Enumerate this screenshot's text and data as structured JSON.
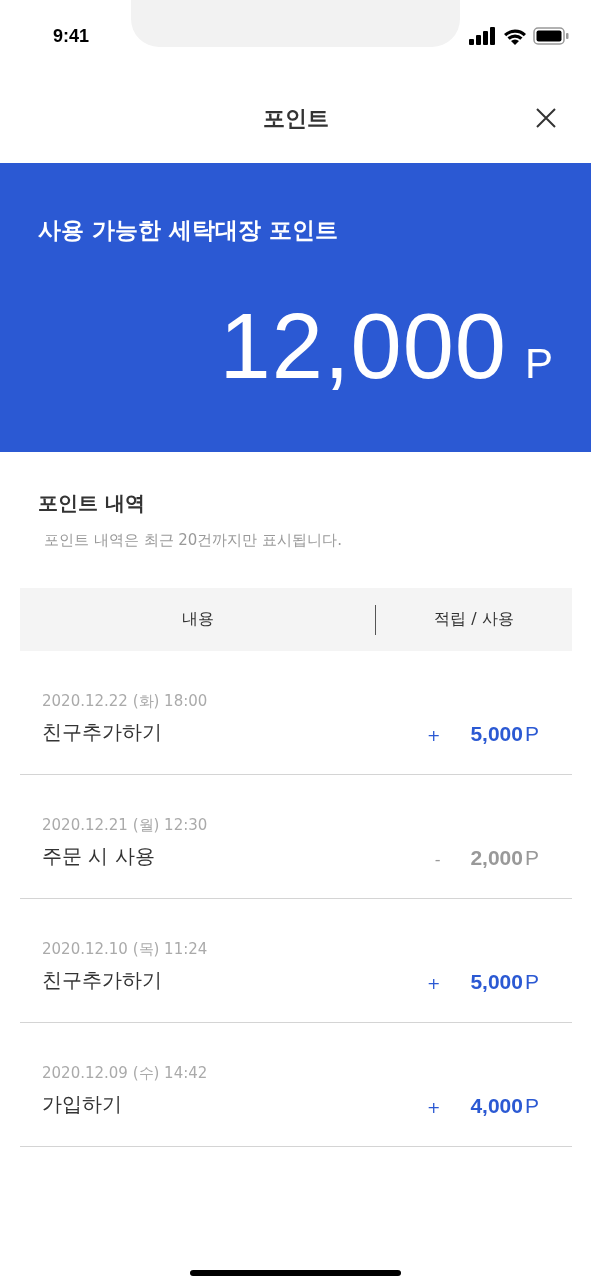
{
  "status_bar": {
    "time": "9:41"
  },
  "header": {
    "title": "포인트"
  },
  "balance": {
    "label": "사용 가능한 세탁대장 포인트",
    "amount": "12,000",
    "unit": "P"
  },
  "history": {
    "title": "포인트 내역",
    "note": "포인트 내역은 최근 20건까지만 표시됩니다.",
    "columns": [
      "내용",
      "적립 / 사용"
    ],
    "rows": [
      {
        "date": "2020.12.22 (화) 18:00",
        "title": "친구추가하기",
        "kind": "earn",
        "sign": "+",
        "amount": "5,000",
        "unit": "P"
      },
      {
        "date": "2020.12.21 (월) 12:30",
        "title": "주문 시 사용",
        "kind": "use",
        "sign": "-",
        "amount": "2,000",
        "unit": "P"
      },
      {
        "date": "2020.12.10 (목) 11:24",
        "title": "친구추가하기",
        "kind": "earn",
        "sign": "+",
        "amount": "5,000",
        "unit": "P"
      },
      {
        "date": "2020.12.09 (수) 14:42",
        "title": "가입하기",
        "kind": "earn",
        "sign": "+",
        "amount": "4,000",
        "unit": "P"
      }
    ]
  }
}
